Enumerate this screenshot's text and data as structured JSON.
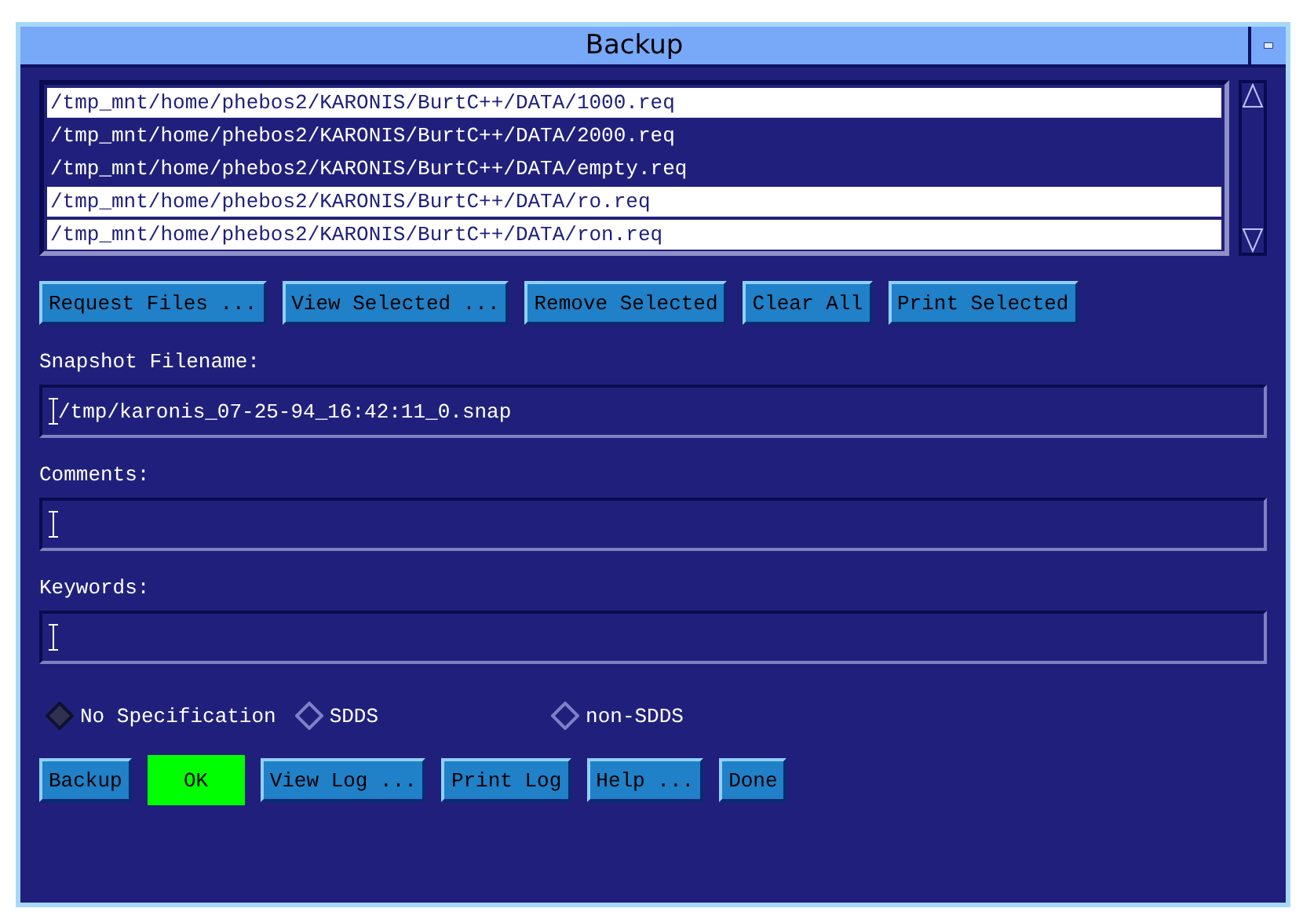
{
  "window": {
    "title": "Backup"
  },
  "files": [
    {
      "path": "/tmp_mnt/home/phebos2/KARONIS/BurtC++/DATA/1000.req",
      "selected": true
    },
    {
      "path": "/tmp_mnt/home/phebos2/KARONIS/BurtC++/DATA/2000.req",
      "selected": false
    },
    {
      "path": "/tmp_mnt/home/phebos2/KARONIS/BurtC++/DATA/empty.req",
      "selected": false
    },
    {
      "path": "/tmp_mnt/home/phebos2/KARONIS/BurtC++/DATA/ro.req",
      "selected": true
    },
    {
      "path": "/tmp_mnt/home/phebos2/KARONIS/BurtC++/DATA/ron.req",
      "selected": true
    }
  ],
  "file_buttons": [
    "Request Files ...",
    "View Selected ...",
    "Remove Selected",
    "Clear All",
    "Print Selected"
  ],
  "fields": [
    {
      "label": "Snapshot Filename:",
      "value": "/tmp/karonis_07-25-94_16:42:11_0.snap"
    },
    {
      "label": "Comments:"
    },
    {
      "label": "Keywords:"
    }
  ],
  "format": [
    {
      "label": "No Specification",
      "selected": true
    },
    {
      "label": "SDDS",
      "selected": false
    },
    {
      "label": "non-SDDS",
      "selected": false
    }
  ],
  "actions": [
    {
      "label": "Backup",
      "highlighted": false
    },
    {
      "label": "OK",
      "highlighted": true
    },
    {
      "label": "View Log ...",
      "highlighted": false
    },
    {
      "label": "Print Log",
      "highlighted": false
    },
    {
      "label": "Help ...",
      "highlighted": false
    },
    {
      "label": "Done",
      "highlighted": false
    }
  ]
}
